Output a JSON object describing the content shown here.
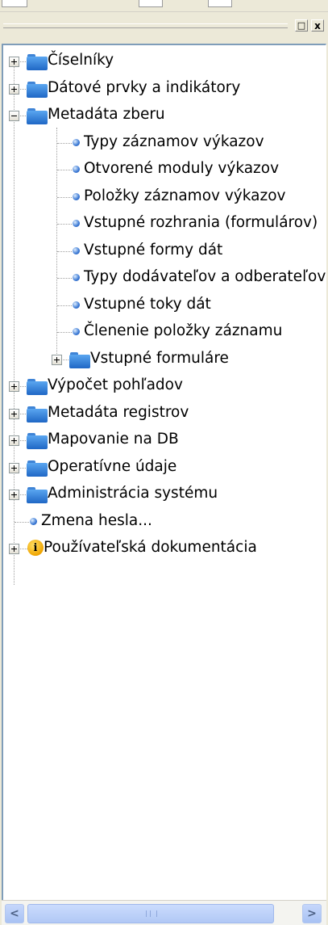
{
  "window": {
    "restore_glyph": "□",
    "close_glyph": "x"
  },
  "tree": {
    "items": [
      {
        "label": "Číselníky",
        "icon": "folder-icon",
        "expander": "plus"
      },
      {
        "label": "Dátové prvky a indikátory",
        "icon": "folder-icon",
        "expander": "plus"
      },
      {
        "label": "Metadáta zberu",
        "icon": "folder-icon",
        "expander": "minus"
      },
      {
        "label": "Typy záznamov výkazov",
        "icon": "bullet-icon"
      },
      {
        "label": "Otvorené moduly výkazov",
        "icon": "bullet-icon"
      },
      {
        "label": "Položky záznamov výkazov",
        "icon": "bullet-icon"
      },
      {
        "label": "Vstupné rozhrania (formulárov)",
        "icon": "bullet-icon"
      },
      {
        "label": "Vstupné formy dát",
        "icon": "bullet-icon"
      },
      {
        "label": "Typy dodávateľov a odberateľov",
        "icon": "bullet-icon"
      },
      {
        "label": "Vstupné toky dát",
        "icon": "bullet-icon"
      },
      {
        "label": "Členenie položky záznamu",
        "icon": "bullet-icon"
      },
      {
        "label": "Vstupné formuláre",
        "icon": "folder-icon",
        "expander": "plus"
      },
      {
        "label": "Výpočet pohľadov",
        "icon": "folder-icon",
        "expander": "plus"
      },
      {
        "label": "Metadáta registrov",
        "icon": "folder-icon",
        "expander": "plus"
      },
      {
        "label": "Mapovanie na DB",
        "icon": "folder-icon",
        "expander": "plus"
      },
      {
        "label": "Operatívne údaje",
        "icon": "folder-icon",
        "expander": "plus"
      },
      {
        "label": "Administrácia systému",
        "icon": "folder-icon",
        "expander": "plus"
      },
      {
        "label": "Zmena hesla...",
        "icon": "bullet-icon"
      },
      {
        "label": "Používateľská dokumentácia",
        "icon": "info-icon",
        "expander": "plus"
      }
    ]
  },
  "scrollbar": {
    "left_glyph": "<",
    "right_glyph": ">",
    "position": 0
  },
  "colors": {
    "folder": "#2f7fe0",
    "bullet": "#3a78d4",
    "info": "#f0a500",
    "panel_bg": "#ece9d8"
  }
}
